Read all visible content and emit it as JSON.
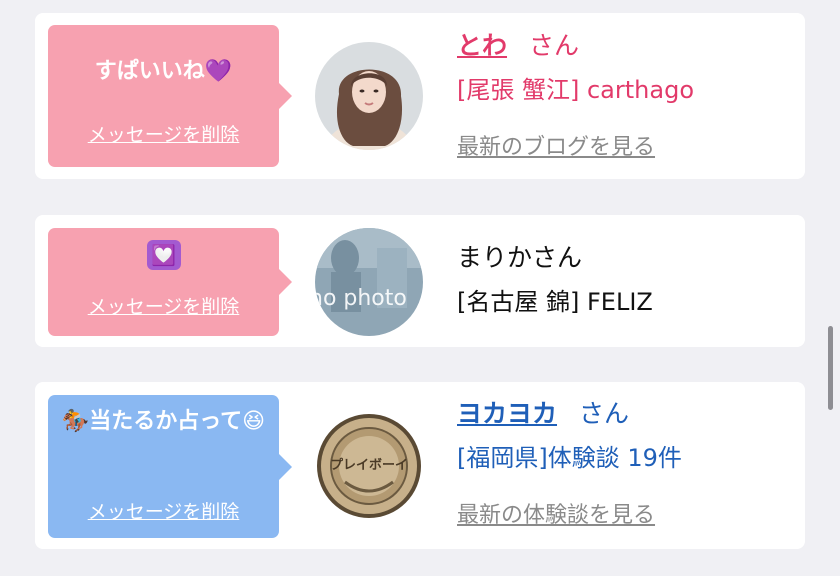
{
  "colors": {
    "pink_bubble": "#f7a1b0",
    "blue_bubble": "#8ab8f2",
    "pink_text": "#e23a6a",
    "blue_text": "#1f5fb8"
  },
  "cards": [
    {
      "message": "すぱいいね💜",
      "delete_label": "メッセージを削除",
      "name": "とわ",
      "san": "さん",
      "shop": "[尾張 蟹江] carthago",
      "more_link": "最新のブログを見る"
    },
    {
      "message": "💟",
      "delete_label": "メッセージを削除",
      "name_plain": "まりかさん",
      "shop": "[名古屋 錦] FELIZ",
      "avatar_text": "no photo"
    },
    {
      "message": "🏇当たるか占って😆",
      "delete_label": "メッセージを削除",
      "name": "ヨカヨカ",
      "san": "さん",
      "shop": "[福岡県]体験談 19件",
      "more_link": "最新の体験談を見る",
      "avatar_coin_text": "プレイボーイ"
    }
  ]
}
